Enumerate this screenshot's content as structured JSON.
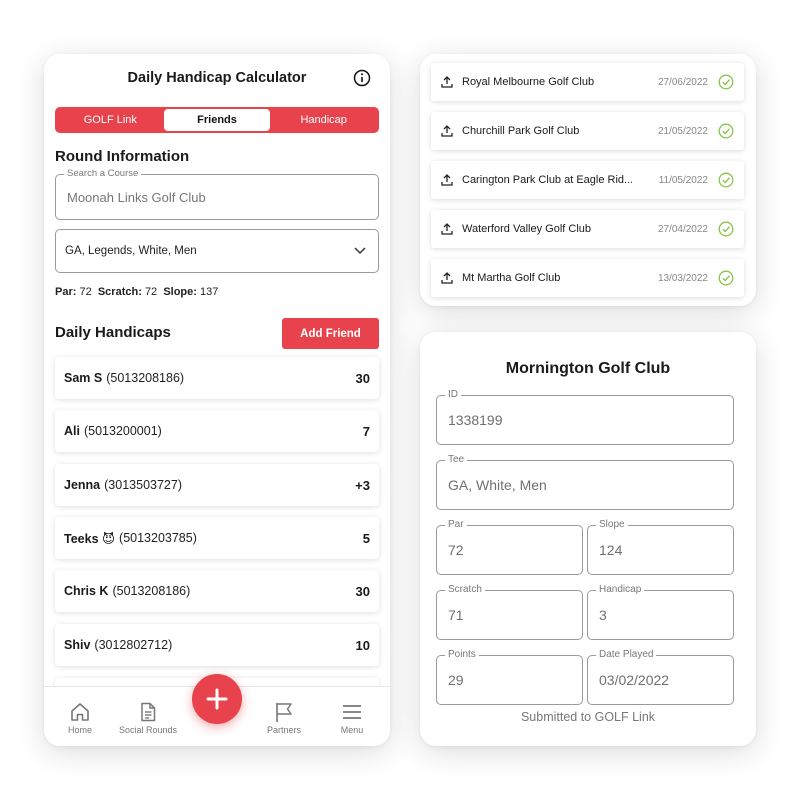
{
  "phone": {
    "title": "Daily Handicap Calculator",
    "tabs": [
      {
        "label": "GOLF Link",
        "active": false
      },
      {
        "label": "Friends",
        "active": true
      },
      {
        "label": "Handicap",
        "active": false
      }
    ],
    "round_info_title": "Round Information",
    "course_search": {
      "legend": "Search a Course",
      "value": "Moonah Links Golf Club"
    },
    "tee_select": {
      "value": "GA, Legends, White, Men"
    },
    "params": {
      "par_label": "Par:",
      "par": "72",
      "scratch_label": "Scratch:",
      "scratch": "72",
      "slope_label": "Slope:",
      "slope": "137"
    },
    "daily_title": "Daily Handicaps",
    "add_friend_label": "Add Friend",
    "friends": [
      {
        "name": "Sam S",
        "id": "(5013208186)",
        "handicap": "30"
      },
      {
        "name": "Ali",
        "id": "(5013200001)",
        "handicap": "7"
      },
      {
        "name": "Jenna",
        "id": "(3013503727)",
        "handicap": "+3"
      },
      {
        "name": "Teeks 😈",
        "id": "(5013203785)",
        "handicap": "5"
      },
      {
        "name": "Chris K",
        "id": "(5013208186)",
        "handicap": "30"
      },
      {
        "name": "Shiv",
        "id": "(3012802712)",
        "handicap": "10"
      }
    ],
    "nav": [
      {
        "label": "Home",
        "icon": "home-icon"
      },
      {
        "label": "Social Rounds",
        "icon": "document-icon"
      },
      {
        "label": "Partners",
        "icon": "flag-icon"
      },
      {
        "label": "Menu",
        "icon": "menu-icon"
      }
    ],
    "fab_icon": "plus-icon"
  },
  "rounds": [
    {
      "course": "Royal Melbourne Golf Club",
      "date": "27/06/2022"
    },
    {
      "course": "Churchill Park Golf Club",
      "date": "21/05/2022"
    },
    {
      "course": "Carington Park Club at Eagle Rid...",
      "date": "11/05/2022"
    },
    {
      "course": "Waterford Valley Golf Club",
      "date": "27/04/2022"
    },
    {
      "course": "Mt Martha Golf Club",
      "date": "13/03/2022"
    }
  ],
  "detail": {
    "title": "Mornington Golf Club",
    "fields": {
      "id": {
        "label": "ID",
        "value": "1338199"
      },
      "tee": {
        "label": "Tee",
        "value": "GA, White, Men"
      },
      "par": {
        "label": "Par",
        "value": "72"
      },
      "slope": {
        "label": "Slope",
        "value": "124"
      },
      "scratch": {
        "label": "Scratch",
        "value": "71"
      },
      "handicap": {
        "label": "Handicap",
        "value": "3"
      },
      "points": {
        "label": "Points",
        "value": "29"
      },
      "date_played": {
        "label": "Date Played",
        "value": "03/02/2022"
      }
    },
    "status": "Submitted to GOLF Link"
  },
  "colors": {
    "accent": "#e8434c",
    "check": "#8bc34a",
    "muted": "#777777"
  }
}
